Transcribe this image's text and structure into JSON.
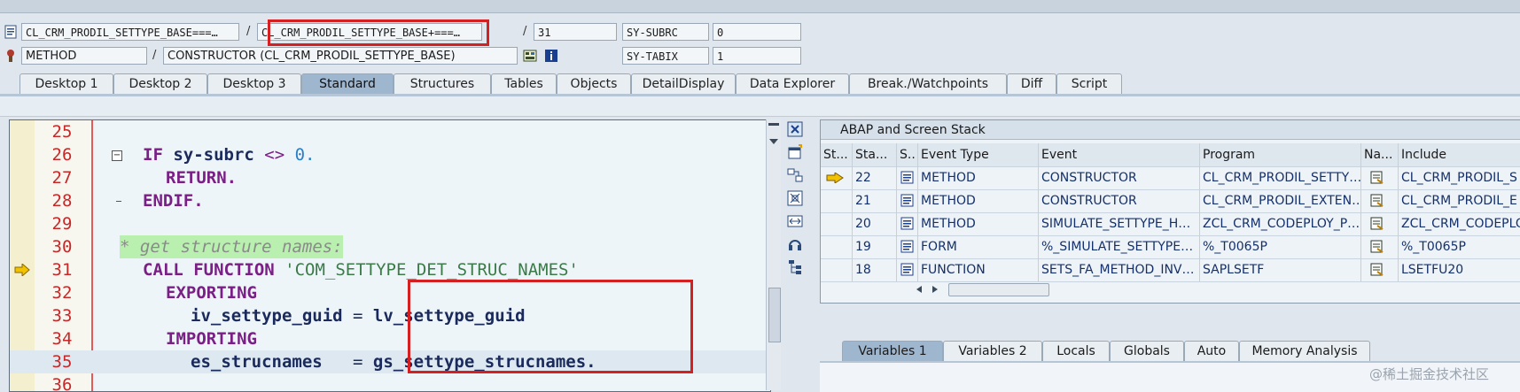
{
  "header": {
    "program_field": "CL_CRM_PRODIL_SETTYPE_BASE===…",
    "class_field": "CL_CRM_PRODIL_SETTYPE_BASE+===…",
    "line_sep": "/",
    "line_field": "31",
    "sysubrc_label": "SY-SUBRC",
    "sysubrc_value": "0",
    "event_type_field": "METHOD",
    "event_sep": "/",
    "event_field": "CONSTRUCTOR (CL_CRM_PRODIL_SETTYPE_BASE)",
    "sytabix_label": "SY-TABIX",
    "sytabix_value": "1"
  },
  "tabs": [
    {
      "label": "Desktop 1"
    },
    {
      "label": "Desktop 2"
    },
    {
      "label": "Desktop 3"
    },
    {
      "label": "Standard"
    },
    {
      "label": "Structures"
    },
    {
      "label": "Tables"
    },
    {
      "label": "Objects"
    },
    {
      "label": "DetailDisplay"
    },
    {
      "label": "Data Explorer"
    },
    {
      "label": "Break./Watchpoints"
    },
    {
      "label": "Diff"
    },
    {
      "label": "Script"
    }
  ],
  "active_tab": "Standard",
  "code": {
    "line_numbers": [
      "25",
      "26",
      "27",
      "28",
      "29",
      "30",
      "31",
      "32",
      "33",
      "34",
      "35",
      "36"
    ],
    "current_line": "31",
    "lines": {
      "l26_kw": "IF",
      "l26_var": " sy-subrc ",
      "l26_op": "<>",
      "l26_num": " 0.",
      "l27": "RETURN.",
      "l28": "ENDIF.",
      "l30": "* get structure names:",
      "l31_kw": "CALL FUNCTION",
      "l31_str": " 'COM_SETTYPE_DET_STRUC_NAMES'",
      "l32": "EXPORTING",
      "l33_param": "iv_settype_guid",
      "l33_eq": " = ",
      "l33_val": "lv_settype_guid",
      "l34": "IMPORTING",
      "l35_param": "es_strucnames",
      "l35_eq": "   = ",
      "l35_val": "gs_settype_strucnames."
    }
  },
  "stack": {
    "title": "ABAP and Screen Stack",
    "columns": [
      "St...",
      "Sta...",
      "S..",
      "Event Type",
      "Event",
      "Program",
      "Na...",
      "Include"
    ],
    "rows": [
      {
        "level": "22",
        "event_type": "METHOD",
        "event": "CONSTRUCTOR",
        "program": "CL_CRM_PRODIL_SETTY…",
        "include": "CL_CRM_PRODIL_S",
        "current": true
      },
      {
        "level": "21",
        "event_type": "METHOD",
        "event": "CONSTRUCTOR",
        "program": "CL_CRM_PRODIL_EXTEN…",
        "include": "CL_CRM_PRODIL_E",
        "current": false
      },
      {
        "level": "20",
        "event_type": "METHOD",
        "event": "SIMULATE_SETTYPE_H…",
        "program": "ZCL_CRM_CODEPLOY_P…",
        "include": "ZCL_CRM_CODEPLO",
        "current": false
      },
      {
        "level": "19",
        "event_type": "FORM",
        "event": "%_SIMULATE_SETTYPE…",
        "program": "%_T0065P",
        "include": "%_T0065P",
        "current": false
      },
      {
        "level": "18",
        "event_type": "FUNCTION",
        "event": "SETS_FA_METHOD_INV…",
        "program": "SAPLSETF",
        "include": "LSETFU20",
        "current": false
      }
    ]
  },
  "variable_tabs": [
    {
      "label": "Variables 1"
    },
    {
      "label": "Variables 2"
    },
    {
      "label": "Locals"
    },
    {
      "label": "Globals"
    },
    {
      "label": "Auto"
    },
    {
      "label": "Memory Analysis"
    }
  ],
  "active_variable_tab": "Variables 1",
  "watermark": "@稀土掘金技术社区",
  "colors": {
    "highlight_red": "#d42020",
    "active_tab": "#9fb6cf",
    "line_number_red": "#c62828",
    "keyword_purple": "#7a1f86",
    "comment_green_bg": "#b9f0b0"
  }
}
